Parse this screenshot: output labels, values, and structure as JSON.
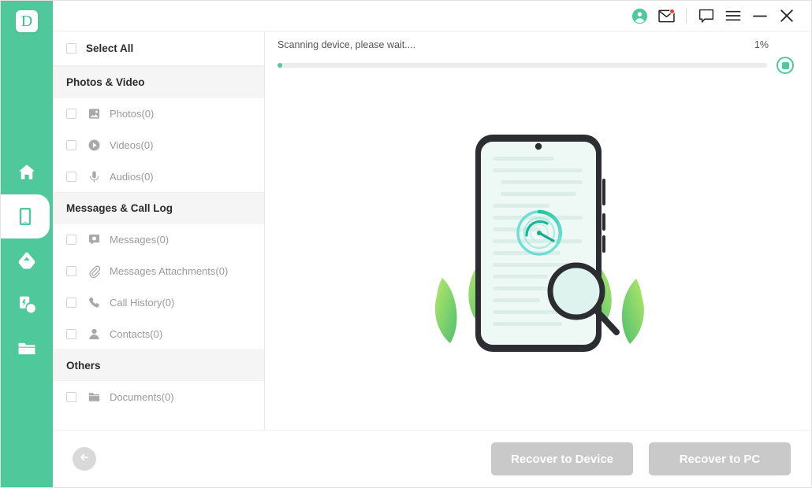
{
  "brand": {
    "logo_letter": "D",
    "accent": "#4fc89c",
    "leaf_green": "#8ed04f",
    "disabled_gray": "#c9c9c9"
  },
  "rail": {
    "items": [
      {
        "name": "home",
        "icon": "home-icon",
        "active": false
      },
      {
        "name": "phone-recovery",
        "icon": "phone-icon",
        "active": true
      },
      {
        "name": "cloud-recovery",
        "icon": "cloud-icon",
        "active": false
      },
      {
        "name": "broken-device",
        "icon": "broken-device-icon",
        "active": false
      },
      {
        "name": "files",
        "icon": "folder-icon",
        "active": false
      }
    ]
  },
  "titlebar": {
    "account_icon": "account-circle-icon",
    "mail_icon": "mail-icon",
    "feedback_icon": "feedback-bubble-icon",
    "menu_icon": "hamburger-menu-icon",
    "minimize_icon": "minimize-icon",
    "close_icon": "close-icon",
    "mail_has_badge": true
  },
  "list": {
    "select_all": "Select All",
    "groups": [
      {
        "title": "Photos & Video",
        "items": [
          {
            "label": "Photos(0)",
            "icon": "photo-icon"
          },
          {
            "label": "Videos(0)",
            "icon": "video-icon"
          },
          {
            "label": "Audios(0)",
            "icon": "audio-icon"
          }
        ]
      },
      {
        "title": "Messages & Call Log",
        "items": [
          {
            "label": "Messages(0)",
            "icon": "message-icon"
          },
          {
            "label": "Messages Attachments(0)",
            "icon": "attachment-icon"
          },
          {
            "label": "Call History(0)",
            "icon": "phone-call-icon"
          },
          {
            "label": "Contacts(0)",
            "icon": "contact-icon"
          }
        ]
      },
      {
        "title": "Others",
        "items": [
          {
            "label": "Documents(0)",
            "icon": "document-folder-icon"
          }
        ]
      }
    ]
  },
  "scan": {
    "status": "Scanning device, please wait....",
    "percent_label": "1%",
    "percent_value": 1,
    "stop_icon": "stop-scan-icon"
  },
  "illustration": {
    "name": "device-scanning-illustration",
    "phone_icon": "phone-outline",
    "radar_icon": "scanning-radar-icon",
    "magnifier_icon": "magnifying-glass-icon",
    "leaves_icon": "leaves-icon"
  },
  "footer": {
    "back_icon": "back-arrow-icon",
    "recover_to_device": "Recover to Device",
    "recover_to_pc": "Recover to PC"
  }
}
